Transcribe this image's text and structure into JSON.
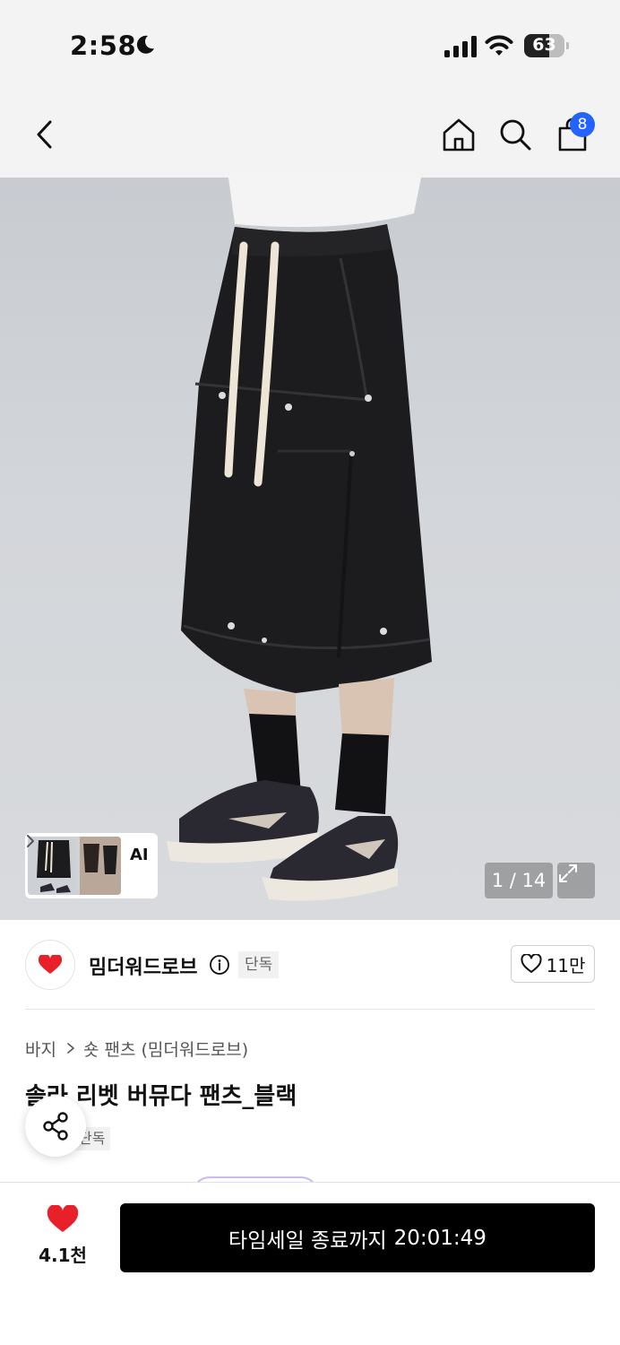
{
  "status_bar": {
    "time": "2:58",
    "battery_percent": "63",
    "battery_level": 0.63
  },
  "nav": {
    "icons": [
      "chevron-left-icon",
      "home-icon",
      "search-icon",
      "shopping-bag-icon"
    ],
    "cart_badge": "8"
  },
  "gallery": {
    "ai_label": "AI",
    "counter": "1 / 14"
  },
  "brand": {
    "name": "밈더워드로브",
    "exclusive_tag": "단독",
    "like_count": "11만"
  },
  "product": {
    "breadcrumb": [
      "바지",
      "숏 팬츠 (밈더워드로브)"
    ],
    "title": "솔라 리벳 버뮤다 팬츠_블랙",
    "exclusive_tag": "단독"
  },
  "bottom": {
    "wish_count": "4.1천",
    "buy_label": "타임세일 종료까지",
    "timer": "20:01:49"
  },
  "colors": {
    "accent_blue": "#2563ff",
    "heart_red": "#e8202a",
    "button_black": "#000000"
  }
}
